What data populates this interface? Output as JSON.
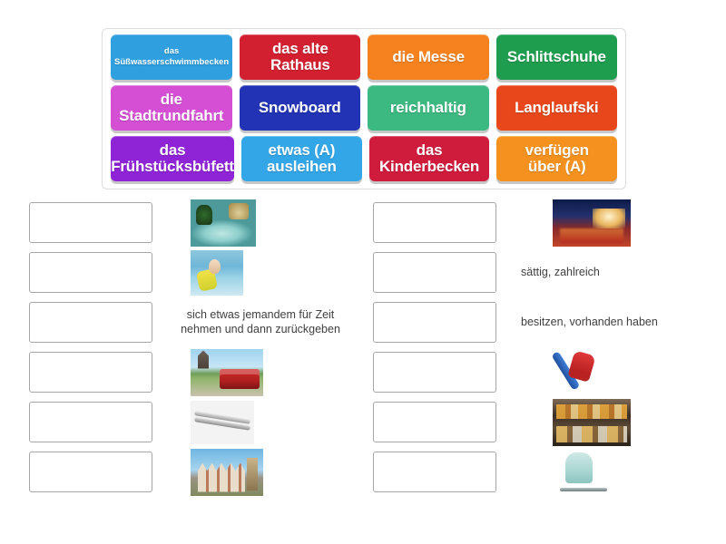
{
  "word_bank": {
    "rows": [
      [
        {
          "label": "das\nSüßwasserschwimmbecken",
          "color": "#2f9fe0",
          "small": true
        },
        {
          "label": "das alte\nRathaus",
          "color": "#d32030",
          "small": false
        },
        {
          "label": "die Messe",
          "color": "#f5821f",
          "small": false
        },
        {
          "label": "Schlittschuhe",
          "color": "#1f9d4f",
          "small": false
        }
      ],
      [
        {
          "label": "die\nStadtrundfahrt",
          "color": "#d44fd4",
          "small": false
        },
        {
          "label": "Snowboard",
          "color": "#2233b5",
          "small": false
        },
        {
          "label": "reichhaltig",
          "color": "#3cb980",
          "small": false
        },
        {
          "label": "Langlaufski",
          "color": "#e8471b",
          "small": false
        }
      ],
      [
        {
          "label": "das\nFrühstücksbüfett",
          "color": "#8e24d6",
          "small": false
        },
        {
          "label": "etwas (A)\nausleihen",
          "color": "#33a6e8",
          "small": false
        },
        {
          "label": "das\nKinderbecken",
          "color": "#d01c3c",
          "small": false
        },
        {
          "label": "verfügen\nüber (A)",
          "color": "#f5921f",
          "small": false
        }
      ]
    ]
  },
  "answers": {
    "left_column": [
      {
        "clue_type": "image",
        "clue_image": "indoor-pool-photo",
        "clue_text": ""
      },
      {
        "clue_type": "image",
        "clue_image": "childrens-paddling-pool-photo",
        "clue_text": ""
      },
      {
        "clue_type": "text",
        "clue_image": "",
        "clue_text": "sich etwas jemandem für Zeit\nnehmen und dann zurückgeben"
      },
      {
        "clue_type": "image",
        "clue_image": "sightseeing-bus-photo",
        "clue_text": ""
      },
      {
        "clue_type": "image",
        "clue_image": "cross-country-skis-photo",
        "clue_text": ""
      },
      {
        "clue_type": "image",
        "clue_image": "old-town-hall-photo",
        "clue_text": ""
      }
    ],
    "right_column": [
      {
        "clue_type": "image",
        "clue_image": "trade-fair-at-night-photo",
        "clue_text": ""
      },
      {
        "clue_type": "text",
        "clue_image": "",
        "clue_text": "sättig, zahlreich"
      },
      {
        "clue_type": "text",
        "clue_image": "",
        "clue_text": "besitzen, vorhanden haben"
      },
      {
        "clue_type": "image",
        "clue_image": "snowboarder-photo",
        "clue_text": ""
      },
      {
        "clue_type": "image",
        "clue_image": "breakfast-buffet-photo",
        "clue_text": ""
      },
      {
        "clue_type": "image",
        "clue_image": "ice-skate-photo",
        "clue_text": ""
      }
    ]
  },
  "colors": {
    "page_background": "#ffffff",
    "box_border": "#a6a6a6",
    "bank_border": "#dcdcdc",
    "clue_text": "#3f3f3f"
  }
}
